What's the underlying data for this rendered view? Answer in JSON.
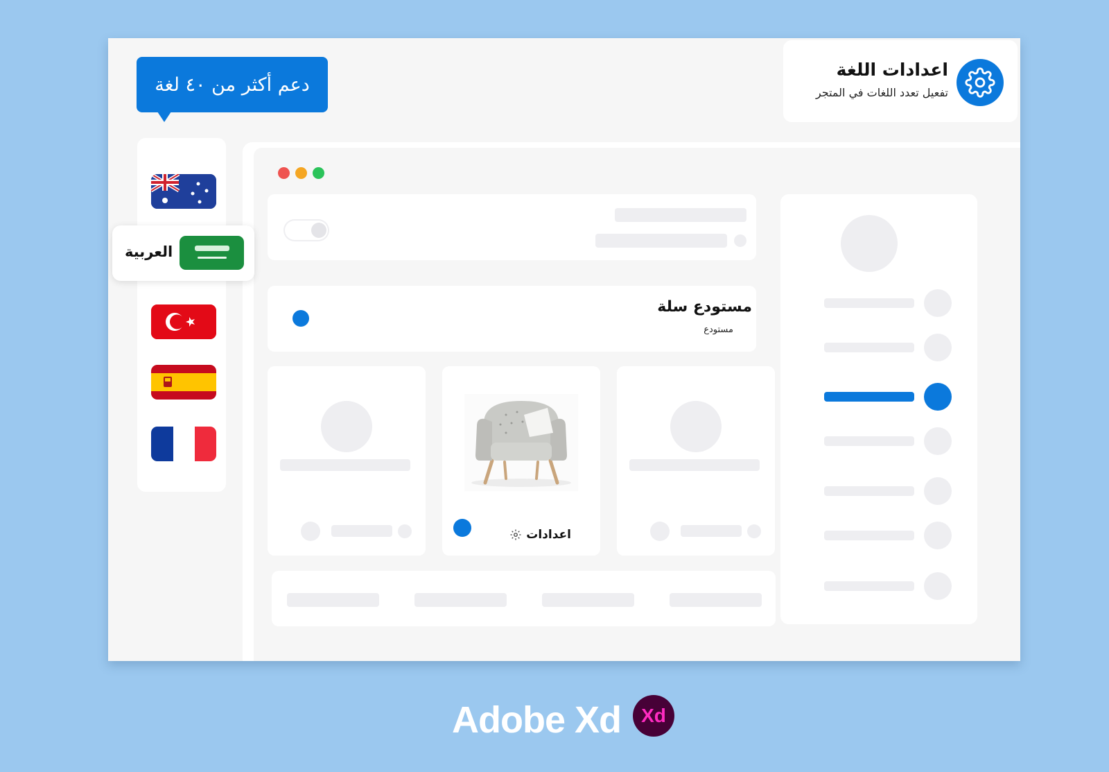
{
  "bubble": {
    "text": "دعم أكثر من ٤٠ لغة"
  },
  "language_settings": {
    "title": "اعدادات اللغة",
    "subtitle": "تفعيل تعدد اللغات في المتجر"
  },
  "languages": {
    "selected_label": "العربية",
    "flags": [
      "australia-flag",
      "saudi-flag",
      "turkey-flag",
      "spain-flag",
      "france-flag"
    ]
  },
  "window_controls": {
    "colors": [
      "#ef5350",
      "#f5a623",
      "#2bc35a"
    ]
  },
  "store": {
    "warehouse_title": "مستودع سلة",
    "warehouse_subtitle": "مستودع",
    "settings_label": "اعدادات"
  },
  "branding": {
    "app_name": "Adobe Xd",
    "icon_text": "Xd"
  },
  "colors": {
    "accent": "#0b79dc",
    "background": "#9bc8ef",
    "placeholder": "#eeeef1"
  }
}
